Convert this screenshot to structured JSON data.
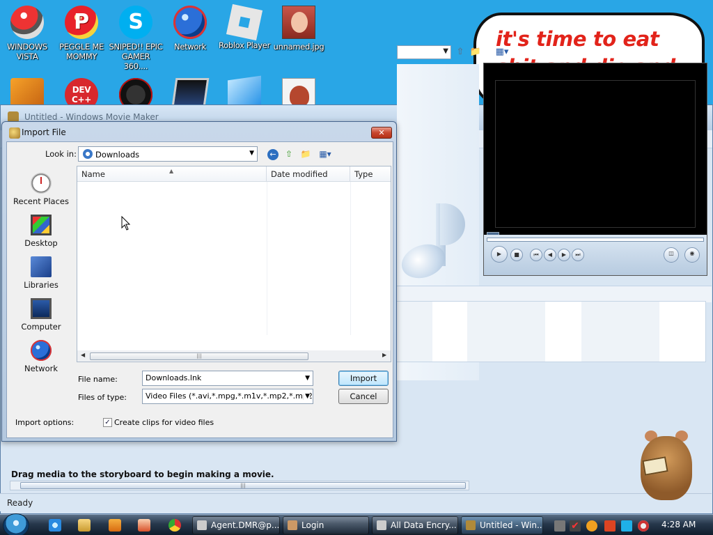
{
  "desktop": {
    "icons_row1": [
      {
        "label": "WINDOWS VISTA",
        "icon": "vista-icon"
      },
      {
        "label": "PEGGLE ME MOMMY",
        "icon": "peggle-icon"
      },
      {
        "label": "SNIPED!! EPIC GAMER 360....",
        "icon": "skype-icon"
      },
      {
        "label": "Network",
        "icon": "network-icon"
      },
      {
        "label": "Roblox Player",
        "icon": "roblox-icon"
      },
      {
        "label": "unnamed.jpg",
        "icon": "photo-icon"
      }
    ],
    "bubble_text": "it's time to eat shit and die and chew bubble gum"
  },
  "movie_maker": {
    "title": "Untitled - Windows Movie Maker",
    "storyboard_hint": "Drag media to the storyboard to begin making a movie.",
    "status": "Ready"
  },
  "dialog": {
    "title": "Import File",
    "look_in_label": "Look in:",
    "look_in_value": "Downloads",
    "places": [
      "Recent Places",
      "Desktop",
      "Libraries",
      "Computer",
      "Network"
    ],
    "columns": [
      "Name",
      "Date modified",
      "Type"
    ],
    "file_name_label": "File name:",
    "file_name_value": "Downloads.lnk",
    "file_type_label": "Files of type:",
    "file_type_value": "Video Files (*.avi,*.mpg,*.m1v,*.mp2,*.mp2v,*.m",
    "import_label": "Import",
    "cancel_label": "Cancel",
    "import_options_label": "Import options:",
    "create_clips_label": "Create clips for video files",
    "create_clips_checked": true
  },
  "taskbar": {
    "buttons": [
      {
        "label": "Agent.DMR@p...",
        "active": false
      },
      {
        "label": "Login",
        "active": false
      },
      {
        "label": "All Data Encry...",
        "active": false
      },
      {
        "label": "Untitled - Win...",
        "active": true
      }
    ],
    "clock": "4:28 AM"
  }
}
